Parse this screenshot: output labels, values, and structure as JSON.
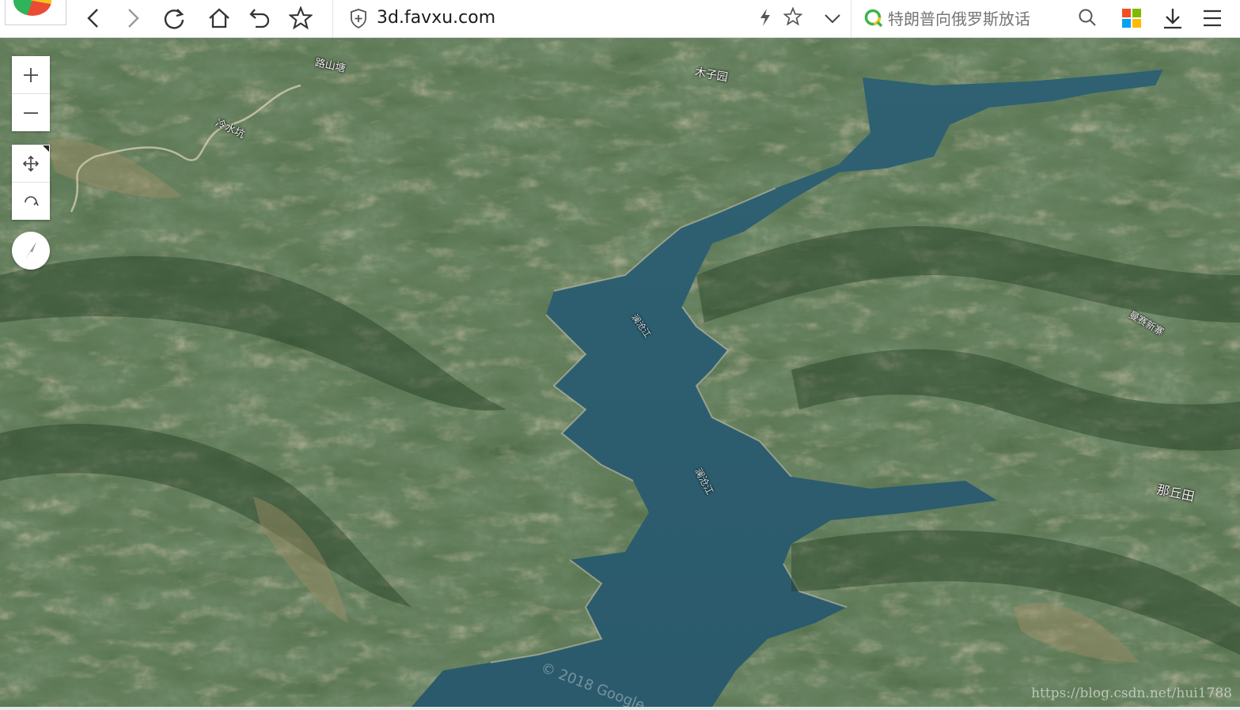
{
  "browser": {
    "url": "3d.favxu.com",
    "search_placeholder": "特朗普向俄罗斯放话",
    "icons": [
      "browser-logo-icon",
      "back-icon",
      "forward-icon",
      "reload-icon",
      "home-icon",
      "undo-icon",
      "bookmark-star-icon",
      "shield-icon",
      "lightning-icon",
      "star-icon",
      "chevron-down-icon",
      "search-brand-icon",
      "search-icon",
      "apps-grid-icon",
      "download-icon",
      "menu-icon"
    ]
  },
  "map": {
    "controls": [
      "zoom-in-icon",
      "zoom-out-icon",
      "pan-icon",
      "rotate-icon",
      "compass-icon"
    ],
    "labels": {
      "village_top_left": "路山塘",
      "village_upper_left": "冷水坑",
      "village_top_center": "木子园",
      "river_upper": "澜沧江",
      "river_lower": "澜沧江",
      "village_right": "曼赛新寨",
      "village_lower_right": "那丘田"
    },
    "copyright": "© 2018 Google",
    "watermark": "https://blog.csdn.net/hui1788"
  },
  "colors": {
    "water": "#2f5f72",
    "forest_dark": "#2c4a2c",
    "forest_mid": "#4a6a3e",
    "bare_ground": "#8a7a58"
  }
}
